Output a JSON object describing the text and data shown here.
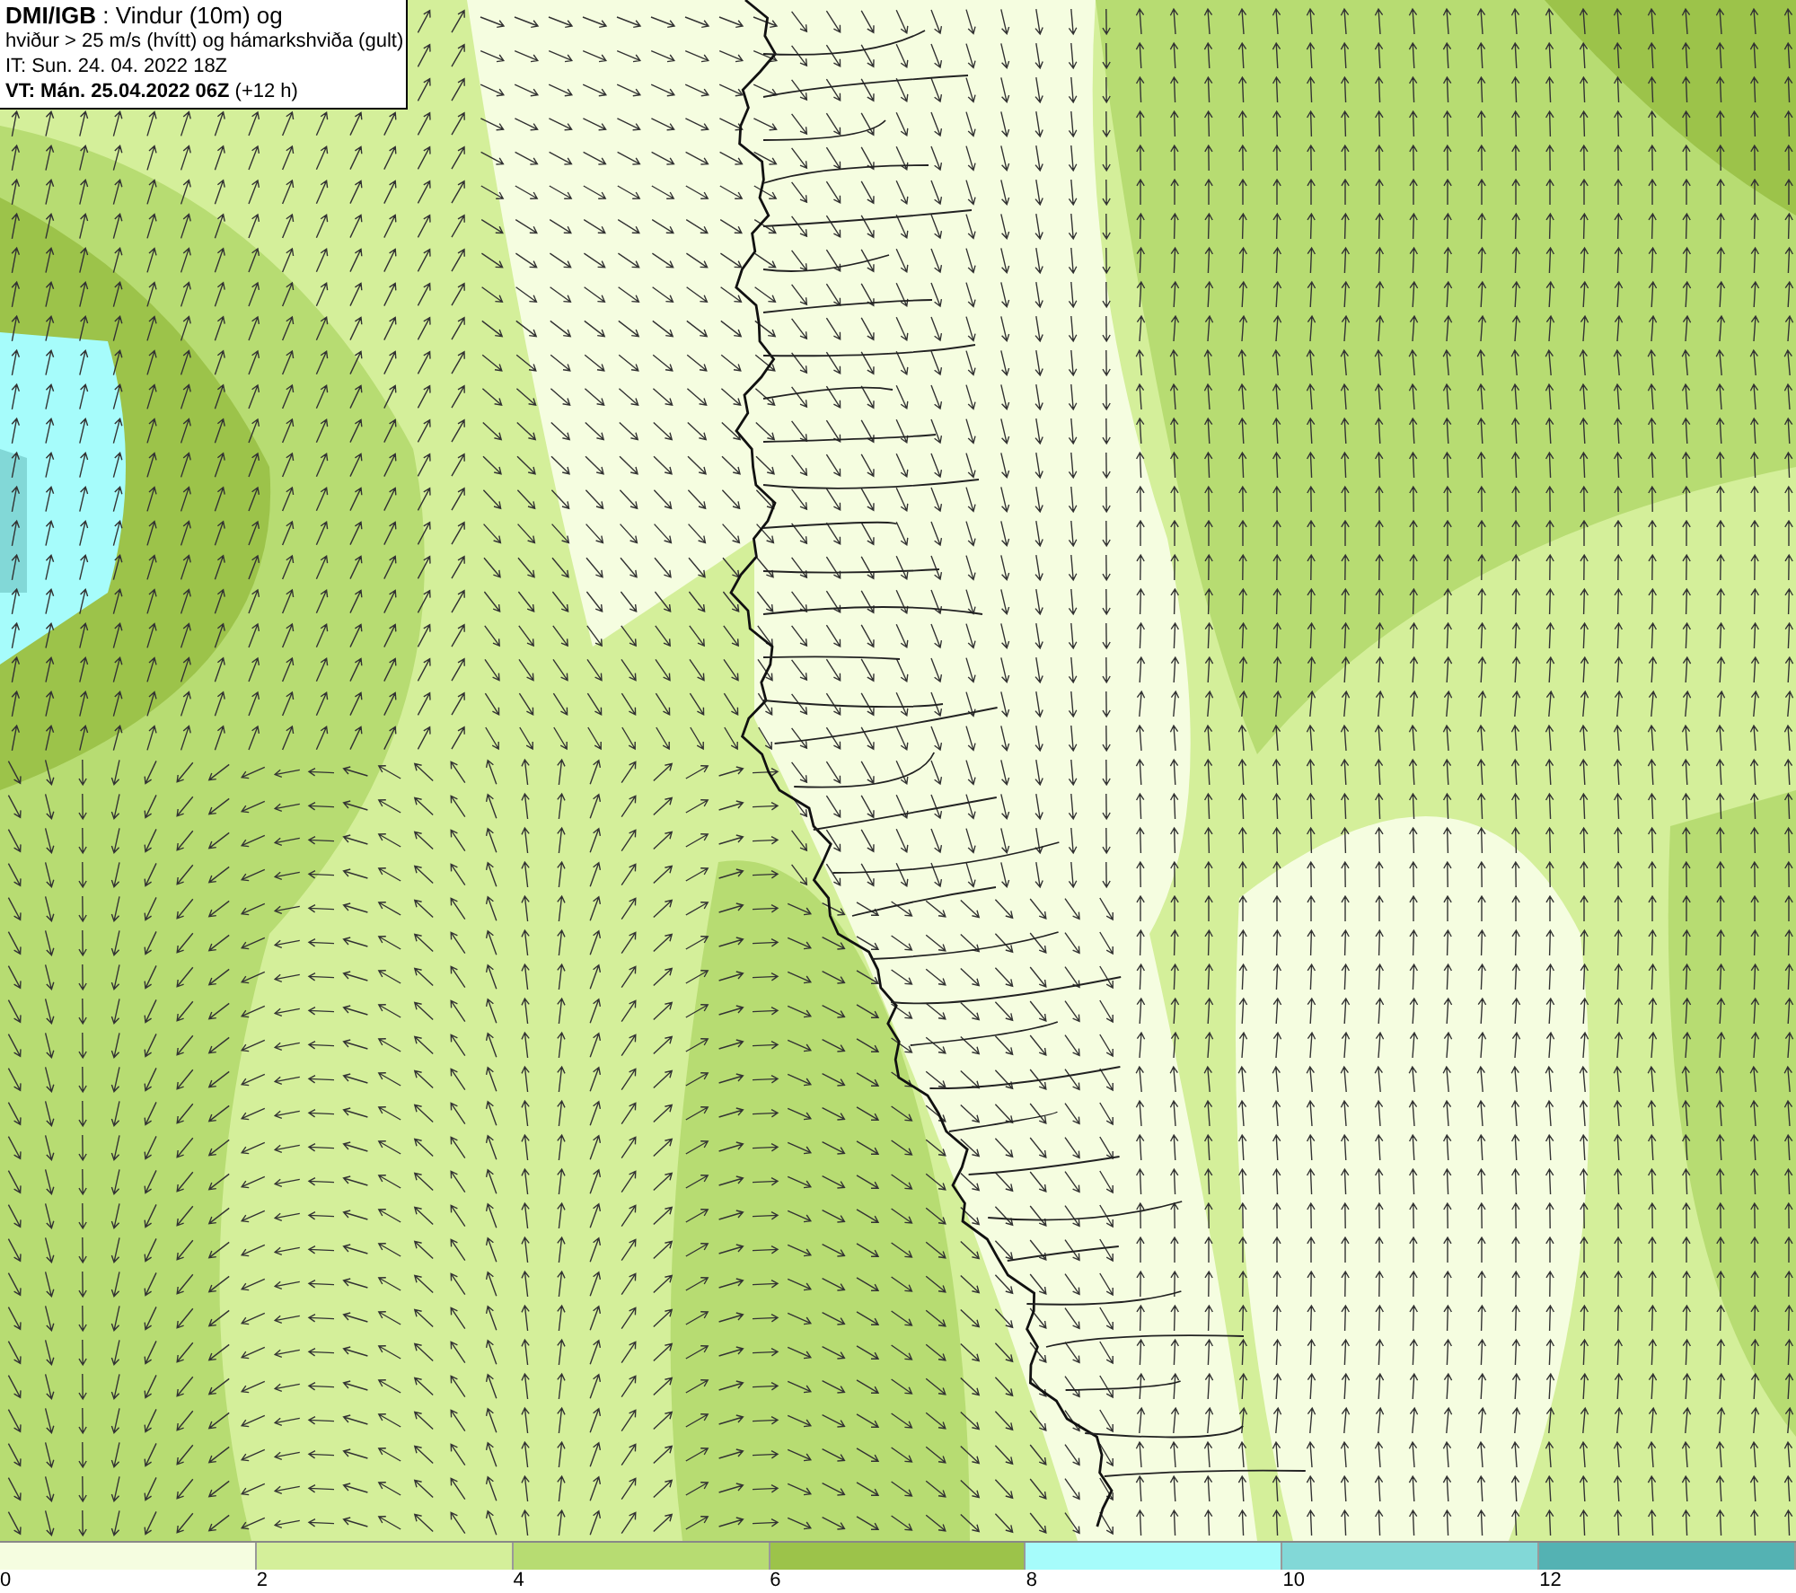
{
  "info_box": {
    "lines": [
      "**DMI/IGB** : Vindur (10m) og",
      "hviður > 25 m/s (hvítt) og hámarkshviða (gult)",
      "IT: Sun. 24. 04. 2022 18Z",
      "**VT: Mán. 25.04.2022 06Z** (+12 h)"
    ]
  },
  "legend": {
    "segments": [
      {
        "color": "#f5fde0",
        "label": "0"
      },
      {
        "color": "#d4ef9a",
        "label": "2"
      },
      {
        "color": "#b7dc72",
        "label": "4"
      },
      {
        "color": "#9cc34a",
        "label": "6"
      },
      {
        "color": "#a6fcfb",
        "label": "8"
      },
      {
        "color": "#82d8d7",
        "label": "10"
      },
      {
        "color": "#54b2b3",
        "label": "12"
      }
    ]
  }
}
